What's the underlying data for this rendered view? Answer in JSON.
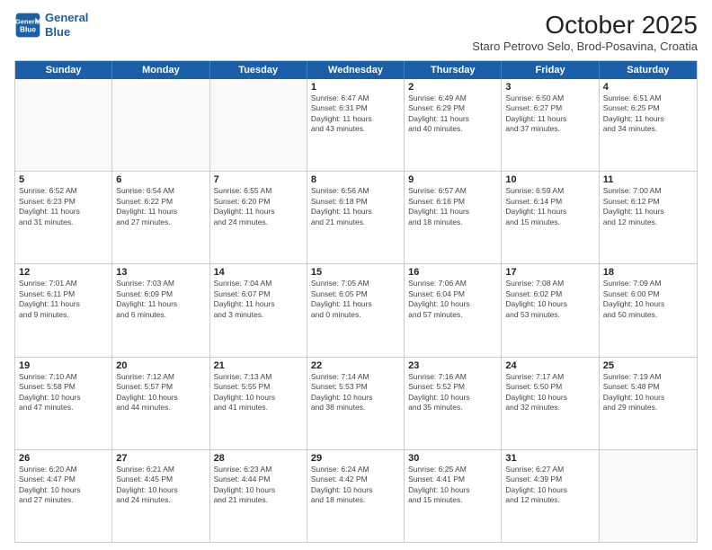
{
  "header": {
    "logo_line1": "General",
    "logo_line2": "Blue",
    "month_title": "October 2025",
    "location": "Staro Petrovo Selo, Brod-Posavina, Croatia"
  },
  "day_headers": [
    "Sunday",
    "Monday",
    "Tuesday",
    "Wednesday",
    "Thursday",
    "Friday",
    "Saturday"
  ],
  "weeks": [
    [
      {
        "num": "",
        "info": ""
      },
      {
        "num": "",
        "info": ""
      },
      {
        "num": "",
        "info": ""
      },
      {
        "num": "1",
        "info": "Sunrise: 6:47 AM\nSunset: 6:31 PM\nDaylight: 11 hours\nand 43 minutes."
      },
      {
        "num": "2",
        "info": "Sunrise: 6:49 AM\nSunset: 6:29 PM\nDaylight: 11 hours\nand 40 minutes."
      },
      {
        "num": "3",
        "info": "Sunrise: 6:50 AM\nSunset: 6:27 PM\nDaylight: 11 hours\nand 37 minutes."
      },
      {
        "num": "4",
        "info": "Sunrise: 6:51 AM\nSunset: 6:25 PM\nDaylight: 11 hours\nand 34 minutes."
      }
    ],
    [
      {
        "num": "5",
        "info": "Sunrise: 6:52 AM\nSunset: 6:23 PM\nDaylight: 11 hours\nand 31 minutes."
      },
      {
        "num": "6",
        "info": "Sunrise: 6:54 AM\nSunset: 6:22 PM\nDaylight: 11 hours\nand 27 minutes."
      },
      {
        "num": "7",
        "info": "Sunrise: 6:55 AM\nSunset: 6:20 PM\nDaylight: 11 hours\nand 24 minutes."
      },
      {
        "num": "8",
        "info": "Sunrise: 6:56 AM\nSunset: 6:18 PM\nDaylight: 11 hours\nand 21 minutes."
      },
      {
        "num": "9",
        "info": "Sunrise: 6:57 AM\nSunset: 6:16 PM\nDaylight: 11 hours\nand 18 minutes."
      },
      {
        "num": "10",
        "info": "Sunrise: 6:59 AM\nSunset: 6:14 PM\nDaylight: 11 hours\nand 15 minutes."
      },
      {
        "num": "11",
        "info": "Sunrise: 7:00 AM\nSunset: 6:12 PM\nDaylight: 11 hours\nand 12 minutes."
      }
    ],
    [
      {
        "num": "12",
        "info": "Sunrise: 7:01 AM\nSunset: 6:11 PM\nDaylight: 11 hours\nand 9 minutes."
      },
      {
        "num": "13",
        "info": "Sunrise: 7:03 AM\nSunset: 6:09 PM\nDaylight: 11 hours\nand 6 minutes."
      },
      {
        "num": "14",
        "info": "Sunrise: 7:04 AM\nSunset: 6:07 PM\nDaylight: 11 hours\nand 3 minutes."
      },
      {
        "num": "15",
        "info": "Sunrise: 7:05 AM\nSunset: 6:05 PM\nDaylight: 11 hours\nand 0 minutes."
      },
      {
        "num": "16",
        "info": "Sunrise: 7:06 AM\nSunset: 6:04 PM\nDaylight: 10 hours\nand 57 minutes."
      },
      {
        "num": "17",
        "info": "Sunrise: 7:08 AM\nSunset: 6:02 PM\nDaylight: 10 hours\nand 53 minutes."
      },
      {
        "num": "18",
        "info": "Sunrise: 7:09 AM\nSunset: 6:00 PM\nDaylight: 10 hours\nand 50 minutes."
      }
    ],
    [
      {
        "num": "19",
        "info": "Sunrise: 7:10 AM\nSunset: 5:58 PM\nDaylight: 10 hours\nand 47 minutes."
      },
      {
        "num": "20",
        "info": "Sunrise: 7:12 AM\nSunset: 5:57 PM\nDaylight: 10 hours\nand 44 minutes."
      },
      {
        "num": "21",
        "info": "Sunrise: 7:13 AM\nSunset: 5:55 PM\nDaylight: 10 hours\nand 41 minutes."
      },
      {
        "num": "22",
        "info": "Sunrise: 7:14 AM\nSunset: 5:53 PM\nDaylight: 10 hours\nand 38 minutes."
      },
      {
        "num": "23",
        "info": "Sunrise: 7:16 AM\nSunset: 5:52 PM\nDaylight: 10 hours\nand 35 minutes."
      },
      {
        "num": "24",
        "info": "Sunrise: 7:17 AM\nSunset: 5:50 PM\nDaylight: 10 hours\nand 32 minutes."
      },
      {
        "num": "25",
        "info": "Sunrise: 7:19 AM\nSunset: 5:48 PM\nDaylight: 10 hours\nand 29 minutes."
      }
    ],
    [
      {
        "num": "26",
        "info": "Sunrise: 6:20 AM\nSunset: 4:47 PM\nDaylight: 10 hours\nand 27 minutes."
      },
      {
        "num": "27",
        "info": "Sunrise: 6:21 AM\nSunset: 4:45 PM\nDaylight: 10 hours\nand 24 minutes."
      },
      {
        "num": "28",
        "info": "Sunrise: 6:23 AM\nSunset: 4:44 PM\nDaylight: 10 hours\nand 21 minutes."
      },
      {
        "num": "29",
        "info": "Sunrise: 6:24 AM\nSunset: 4:42 PM\nDaylight: 10 hours\nand 18 minutes."
      },
      {
        "num": "30",
        "info": "Sunrise: 6:25 AM\nSunset: 4:41 PM\nDaylight: 10 hours\nand 15 minutes."
      },
      {
        "num": "31",
        "info": "Sunrise: 6:27 AM\nSunset: 4:39 PM\nDaylight: 10 hours\nand 12 minutes."
      },
      {
        "num": "",
        "info": ""
      }
    ]
  ]
}
